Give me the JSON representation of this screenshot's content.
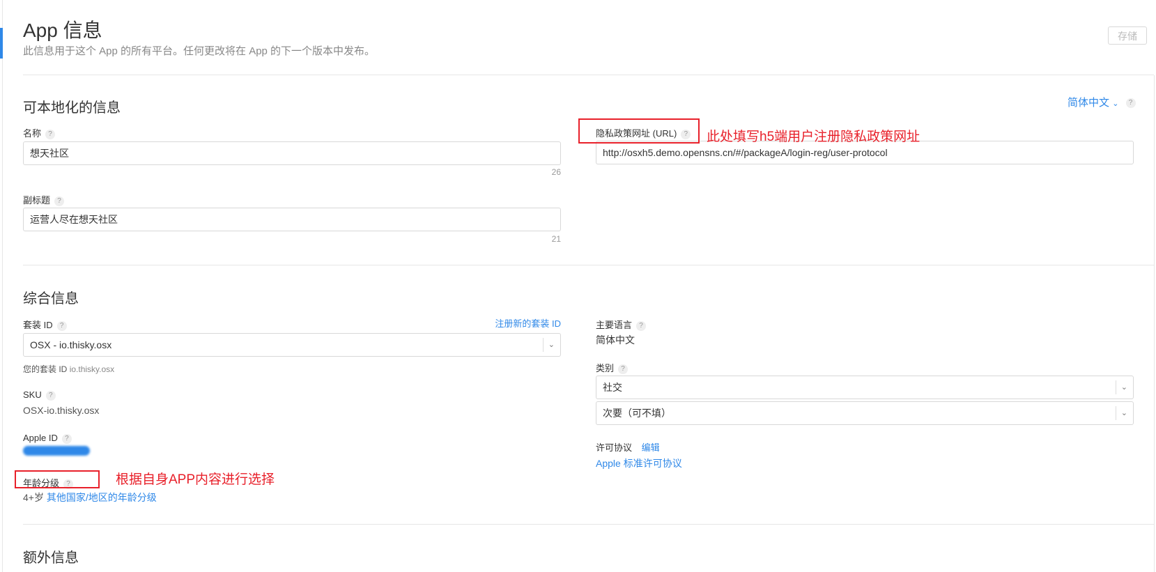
{
  "header": {
    "title": "App 信息",
    "subtitle": "此信息用于这个 App 的所有平台。任何更改将在 App 的下一个版本中发布。",
    "save_label": "存储"
  },
  "localizable": {
    "section_title": "可本地化的信息",
    "language_label": "简体中文",
    "name": {
      "label": "名称",
      "value": "想天社区",
      "counter": "26"
    },
    "subtitle": {
      "label": "副标题",
      "value": "运营人尽在想天社区",
      "counter": "21"
    },
    "privacy": {
      "label": "隐私政策网址 (URL)",
      "value": "http://osxh5.demo.opensns.cn/#/packageA/login-reg/user-protocol"
    }
  },
  "general": {
    "section_title": "综合信息",
    "bundle": {
      "label": "套装 ID",
      "register_link": "注册新的套装 ID",
      "selected": "OSX - io.thisky.osx",
      "yours_label": "您的套装 ID",
      "yours_value": "io.thisky.osx"
    },
    "sku": {
      "label": "SKU",
      "value": "OSX-io.thisky.osx"
    },
    "apple_id": {
      "label": "Apple ID"
    },
    "age": {
      "label": "年龄分级",
      "value": "4+岁",
      "link": "其他国家/地区的年龄分级"
    },
    "primary_language": {
      "label": "主要语言",
      "value": "简体中文"
    },
    "category": {
      "label": "类别",
      "primary": "社交",
      "secondary": "次要（可不填）"
    },
    "license": {
      "label": "许可协议",
      "edit_link": "编辑",
      "value_link": "Apple 标准许可协议"
    }
  },
  "extra": {
    "section_title": "额外信息"
  },
  "annotations": {
    "privacy_note": "此处填写h5端用户注册隐私政策网址",
    "age_note": "根据自身APP内容进行选择"
  },
  "icons": {
    "help": "question-mark-icon",
    "chevron": "chevron-down-icon"
  },
  "colors": {
    "accent": "#2f88e8",
    "annotation": "#e8202a"
  }
}
